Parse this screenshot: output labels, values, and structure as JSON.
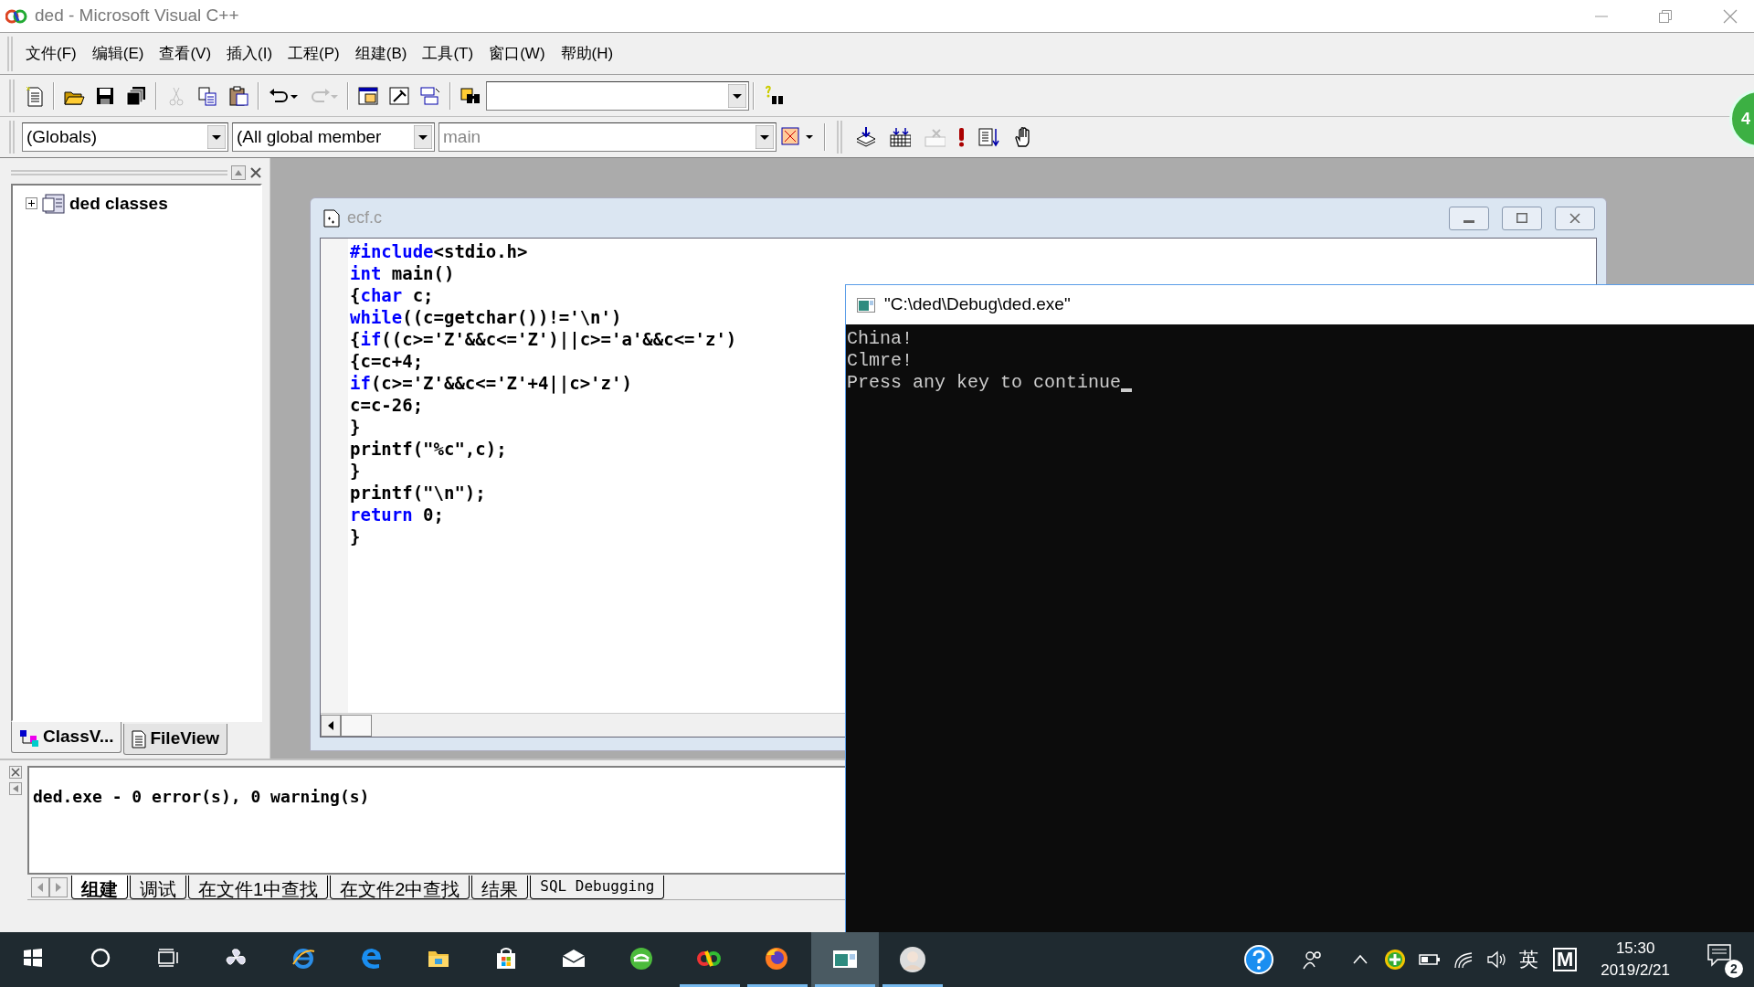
{
  "window": {
    "title": "ded - Microsoft Visual C++"
  },
  "menu": [
    "文件(F)",
    "编辑(E)",
    "查看(V)",
    "插入(I)",
    "工程(P)",
    "组建(B)",
    "工具(T)",
    "窗口(W)",
    "帮助(H)"
  ],
  "toolbar_standard": [
    {
      "kind": "new",
      "disabled": false
    },
    {
      "kind": "sep"
    },
    {
      "kind": "open",
      "disabled": false
    },
    {
      "kind": "save",
      "disabled": false
    },
    {
      "kind": "saveall",
      "disabled": false
    },
    {
      "kind": "sep"
    },
    {
      "kind": "cut",
      "disabled": true
    },
    {
      "kind": "copy",
      "disabled": false
    },
    {
      "kind": "paste",
      "disabled": false
    },
    {
      "kind": "sep"
    },
    {
      "kind": "undo",
      "disabled": false
    },
    {
      "kind": "redo",
      "disabled": true
    },
    {
      "kind": "sep"
    },
    {
      "kind": "workspace",
      "disabled": false
    },
    {
      "kind": "output",
      "disabled": false
    },
    {
      "kind": "windows",
      "disabled": false
    },
    {
      "kind": "sep"
    },
    {
      "kind": "findfiles",
      "disabled": false
    },
    {
      "kind": "findcombo"
    },
    {
      "kind": "sep"
    },
    {
      "kind": "search",
      "disabled": false
    }
  ],
  "wizard_bar": {
    "class_combo": "(Globals)",
    "filter_combo": "(All global member",
    "members_combo": "main"
  },
  "toolbar_build": [
    {
      "kind": "compile",
      "disabled": false
    },
    {
      "kind": "build",
      "disabled": false
    },
    {
      "kind": "stop",
      "disabled": true
    },
    {
      "kind": "execute",
      "disabled": false
    },
    {
      "kind": "debug",
      "disabled": false
    },
    {
      "kind": "breakpoint",
      "disabled": false
    }
  ],
  "floating_badge": "4",
  "workspace": {
    "tree": [
      {
        "label": "ded classes",
        "expanded": false
      }
    ],
    "tabs": [
      {
        "label": "ClassV...",
        "kind": "classview",
        "selected": true
      },
      {
        "label": "FileView",
        "kind": "fileview",
        "selected": false
      }
    ]
  },
  "editor": {
    "title": "ecf.c",
    "lines": [
      [
        {
          "text": "#include",
          "kind": "keyword"
        },
        {
          "text": "<stdio.h>",
          "kind": "plain"
        }
      ],
      [
        {
          "text": "int",
          "kind": "keyword"
        },
        {
          "text": " main()",
          "kind": "plain"
        }
      ],
      [
        {
          "text": "{",
          "kind": "plain"
        },
        {
          "text": "char",
          "kind": "keyword"
        },
        {
          "text": " c;",
          "kind": "plain"
        }
      ],
      [
        {
          "text": "while",
          "kind": "keyword"
        },
        {
          "text": "((c=getchar())!='\\n')",
          "kind": "plain"
        }
      ],
      [
        {
          "text": "{",
          "kind": "plain"
        },
        {
          "text": "if",
          "kind": "keyword"
        },
        {
          "text": "((c>='Z'&&c<='Z')||c>='a'&&c<='z')",
          "kind": "plain"
        }
      ],
      [
        {
          "text": "{c=c+4;",
          "kind": "plain"
        }
      ],
      [
        {
          "text": "if",
          "kind": "keyword"
        },
        {
          "text": "(c>='Z'&&c<='Z'+4||c>'z')",
          "kind": "plain"
        }
      ],
      [
        {
          "text": "c=c-26;",
          "kind": "plain"
        }
      ],
      [
        {
          "text": "}",
          "kind": "plain"
        }
      ],
      [
        {
          "text": "printf(\"%c\",c);",
          "kind": "plain"
        }
      ],
      [
        {
          "text": "}",
          "kind": "plain"
        }
      ],
      [
        {
          "text": "printf(\"\\n\");",
          "kind": "plain"
        }
      ],
      [
        {
          "text": "return",
          "kind": "keyword"
        },
        {
          "text": " 0;",
          "kind": "plain"
        }
      ],
      [
        {
          "text": "}",
          "kind": "plain"
        }
      ]
    ]
  },
  "output": {
    "lines": [
      "ded.exe - 0 error(s), 0 warning(s)"
    ],
    "tabs": [
      {
        "label": "组建",
        "selected": true
      },
      {
        "label": "调试",
        "selected": false
      },
      {
        "label": "在文件1中查找",
        "selected": false
      },
      {
        "label": "在文件2中查找",
        "selected": false
      },
      {
        "label": "结果",
        "selected": false
      },
      {
        "label": "SQL Debugging",
        "selected": false
      }
    ]
  },
  "console": {
    "title": "\"C:\\ded\\Debug\\ded.exe\"",
    "lines": [
      "China!",
      "Clmre!",
      "Press any key to continue"
    ],
    "cursor": true
  },
  "taskbar": {
    "items": [
      {
        "kind": "start",
        "running": false,
        "active": false
      },
      {
        "kind": "search",
        "running": false,
        "active": false
      },
      {
        "kind": "taskview",
        "running": false,
        "active": false
      },
      {
        "kind": "fan",
        "running": false,
        "active": false
      },
      {
        "kind": "ie",
        "running": false,
        "active": false
      },
      {
        "kind": "edge",
        "running": false,
        "active": false
      },
      {
        "kind": "folder",
        "running": false,
        "active": false
      },
      {
        "kind": "store",
        "running": false,
        "active": false
      },
      {
        "kind": "mail",
        "running": false,
        "active": false
      },
      {
        "kind": "greenbrowser",
        "running": false,
        "active": false
      },
      {
        "kind": "vcpp",
        "running": true,
        "active": false
      },
      {
        "kind": "firefox",
        "running": true,
        "active": false
      },
      {
        "kind": "console",
        "running": true,
        "active": true
      },
      {
        "kind": "avatar",
        "running": true,
        "active": false
      }
    ],
    "tray": {
      "ime": "英",
      "ime_mode": "M",
      "time": "15:30",
      "date": "2019/2/21",
      "notifications": "2"
    }
  }
}
